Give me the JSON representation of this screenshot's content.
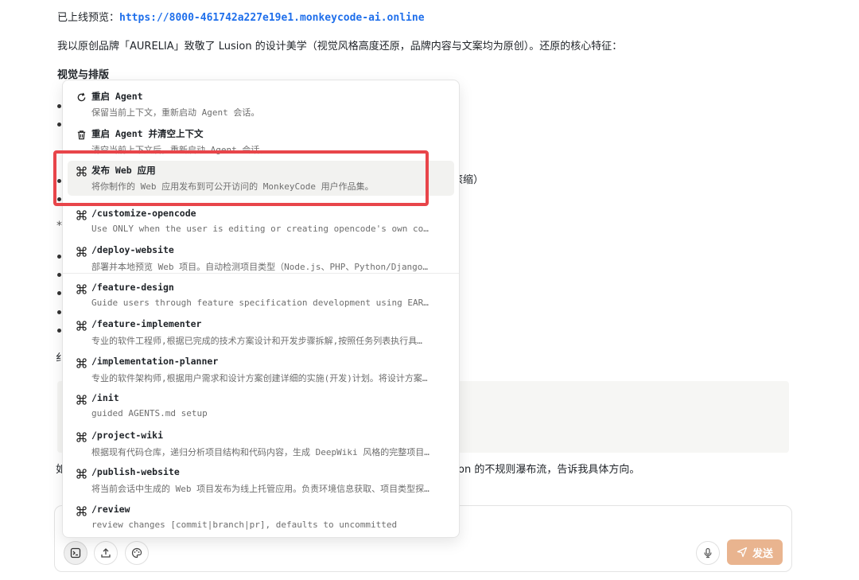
{
  "preview": {
    "label": "已上线预览：",
    "url": "https://8000-461742a227e19e1.monkeycode-ai.online"
  },
  "intro": "我以原创品牌「AURELIA」致敬了 Lusion 的设计美学（视觉风格高度还原，品牌内容与文案均为原创）。还原的核心特征：",
  "section_heading": "视觉与排版",
  "fragments": {
    "scroll_tail": "滚缩）",
    "bottom_tail": "on 的不规则瀑布流，告诉我具体方向。",
    "left_char_1": "纟",
    "left_char_2": "如"
  },
  "menu": {
    "items": [
      {
        "icon": "refresh-icon",
        "title": "重启 Agent",
        "desc": "保留当前上下文，重新启动 Agent 会话。"
      },
      {
        "icon": "trash-icon",
        "title": "重启 Agent 并清空上下文",
        "desc": "清空当前上下文后，重新启动 Agent 会话。"
      },
      {
        "icon": "command-icon",
        "title": "发布 Web 应用",
        "desc": "将你制作的 Web 应用发布到可公开访问的 MonkeyCode 用户作品集。"
      },
      {
        "icon": "command-icon",
        "title": "/customize-opencode",
        "desc": "Use ONLY when the user is editing or creating opencode's own co…"
      },
      {
        "icon": "command-icon",
        "title": "/deploy-website",
        "desc": "部署并本地预览 Web 项目。自动检测项目类型（Node.js、PHP、Python/Django…"
      },
      {
        "icon": "command-icon",
        "title": "/feature-design",
        "desc": "Guide users through feature specification development using EAR…"
      },
      {
        "icon": "command-icon",
        "title": "/feature-implementer",
        "desc": "专业的软件工程师,根据已完成的技术方案设计和开发步骤拆解,按照任务列表执行具…"
      },
      {
        "icon": "command-icon",
        "title": "/implementation-planner",
        "desc": "专业的软件架构师,根据用户需求和设计方案创建详细的实施(开发)计划。将设计方案…"
      },
      {
        "icon": "command-icon",
        "title": "/init",
        "desc": "guided AGENTS.md setup"
      },
      {
        "icon": "command-icon",
        "title": "/project-wiki",
        "desc": "根据现有代码仓库，递归分析项目结构和代码内容，生成 DeepWiki 风格的完整项目…"
      },
      {
        "icon": "command-icon",
        "title": "/publish-website",
        "desc": "将当前会话中生成的 Web 项目发布为线上托管应用。负责环境信息获取、项目类型探…"
      },
      {
        "icon": "command-icon",
        "title": "/review",
        "desc": "review changes [commit|branch|pr], defaults to uncommitted"
      }
    ]
  },
  "composer": {
    "send_label": "发送"
  },
  "colors": {
    "highlight": "#e8454a",
    "send_button": "#e9b48f",
    "link": "#1f6feb"
  }
}
